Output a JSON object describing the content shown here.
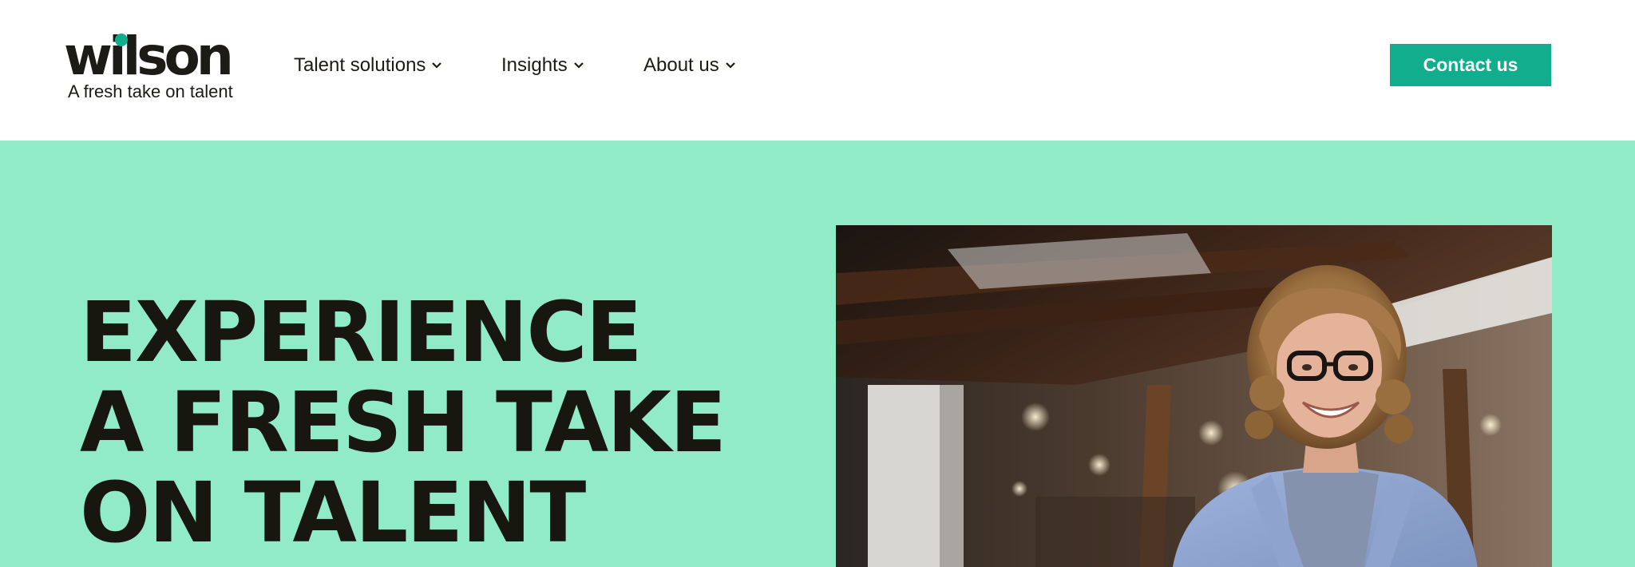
{
  "brand": {
    "name": "wilson",
    "tagline": "A fresh take on talent",
    "accent_color": "#12ad8d",
    "hero_bg_color": "#92ebc7",
    "text_color": "#1c1b15"
  },
  "nav": {
    "items": [
      {
        "label": "Talent solutions",
        "icon": "chevron-down-icon"
      },
      {
        "label": "Insights",
        "icon": "chevron-down-icon"
      },
      {
        "label": "About us",
        "icon": "chevron-down-icon"
      }
    ]
  },
  "header": {
    "contact_label": "Contact us"
  },
  "hero": {
    "headline_lines": [
      "EXPERIENCE",
      "A FRESH TAKE",
      "ON TALENT"
    ],
    "image": "photo of smiling woman with curly hair and glasses in blue blazer in an office"
  }
}
